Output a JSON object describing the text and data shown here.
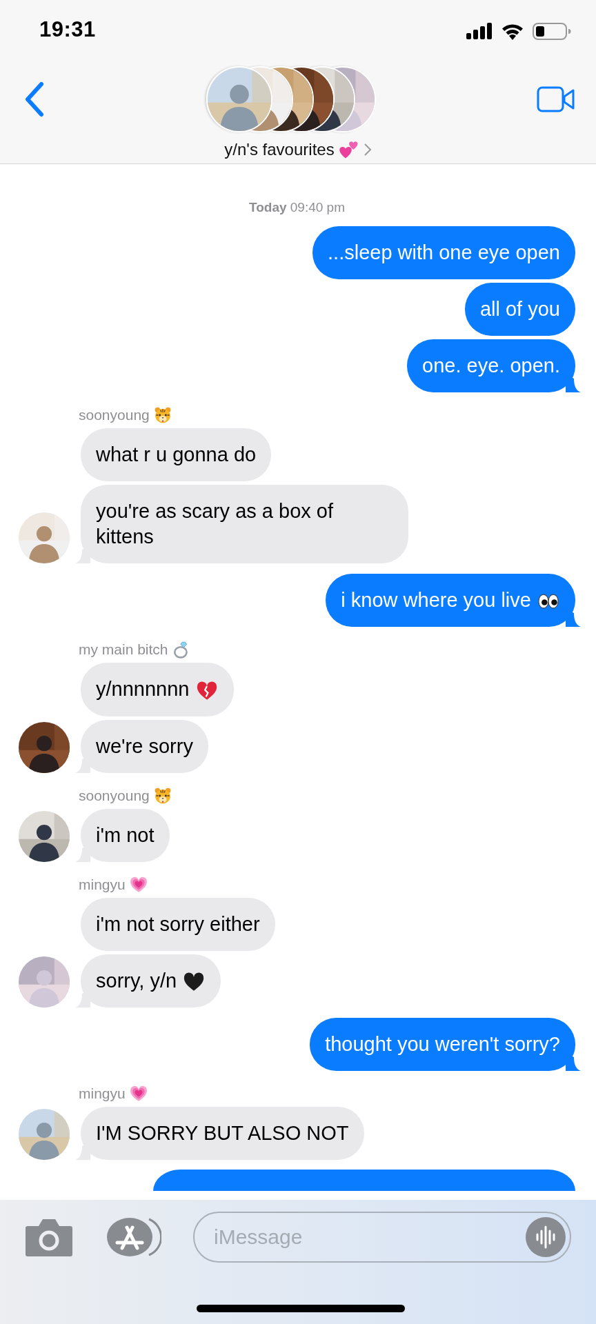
{
  "status_bar": {
    "time": "19:31"
  },
  "header": {
    "title": "y/n's favourites",
    "title_emoji": {
      "kind": "two-hearts"
    }
  },
  "timestamp": "**Today** 09:40 pm",
  "groups": [
    {
      "kind": "outgoing",
      "messages": [
        {
          "text": "...sleep with one eye open"
        },
        {
          "text": "all of you"
        },
        {
          "text": "one. eye. open."
        }
      ]
    },
    {
      "kind": "incoming",
      "sender": "soonyoung",
      "sender_emoji": {
        "kind": "tiger"
      },
      "messages": [
        {
          "text": "what r u gonna do"
        },
        {
          "text": "you're as scary as a box of kittens"
        }
      ]
    },
    {
      "kind": "outgoing",
      "messages": [
        {
          "text": "i know where you live",
          "emoji": {
            "kind": "eyes"
          }
        }
      ]
    },
    {
      "kind": "incoming",
      "sender": "my main bitch",
      "sender_emoji": {
        "kind": "ring"
      },
      "messages": [
        {
          "text": "y/nnnnnnn",
          "emoji": {
            "kind": "broken-heart"
          }
        },
        {
          "text": "we're sorry"
        }
      ]
    },
    {
      "kind": "incoming",
      "sender": "soonyoung",
      "sender_emoji": {
        "kind": "tiger"
      },
      "messages": [
        {
          "text": "i'm not"
        }
      ]
    },
    {
      "kind": "incoming",
      "sender": "mingyu",
      "sender_emoji": {
        "kind": "growing-heart"
      },
      "messages": [
        {
          "text": "i'm not sorry either"
        },
        {
          "text": "sorry, y/n",
          "emoji": {
            "kind": "black-heart"
          }
        }
      ]
    },
    {
      "kind": "outgoing",
      "messages": [
        {
          "text": "thought you weren't sorry?"
        }
      ]
    },
    {
      "kind": "incoming",
      "sender": "mingyu",
      "sender_emoji": {
        "kind": "growing-heart"
      },
      "messages": [
        {
          "text": "I'M SORRY BUT ALSO NOT"
        }
      ]
    }
  ],
  "compose": {
    "placeholder": "iMessage"
  }
}
